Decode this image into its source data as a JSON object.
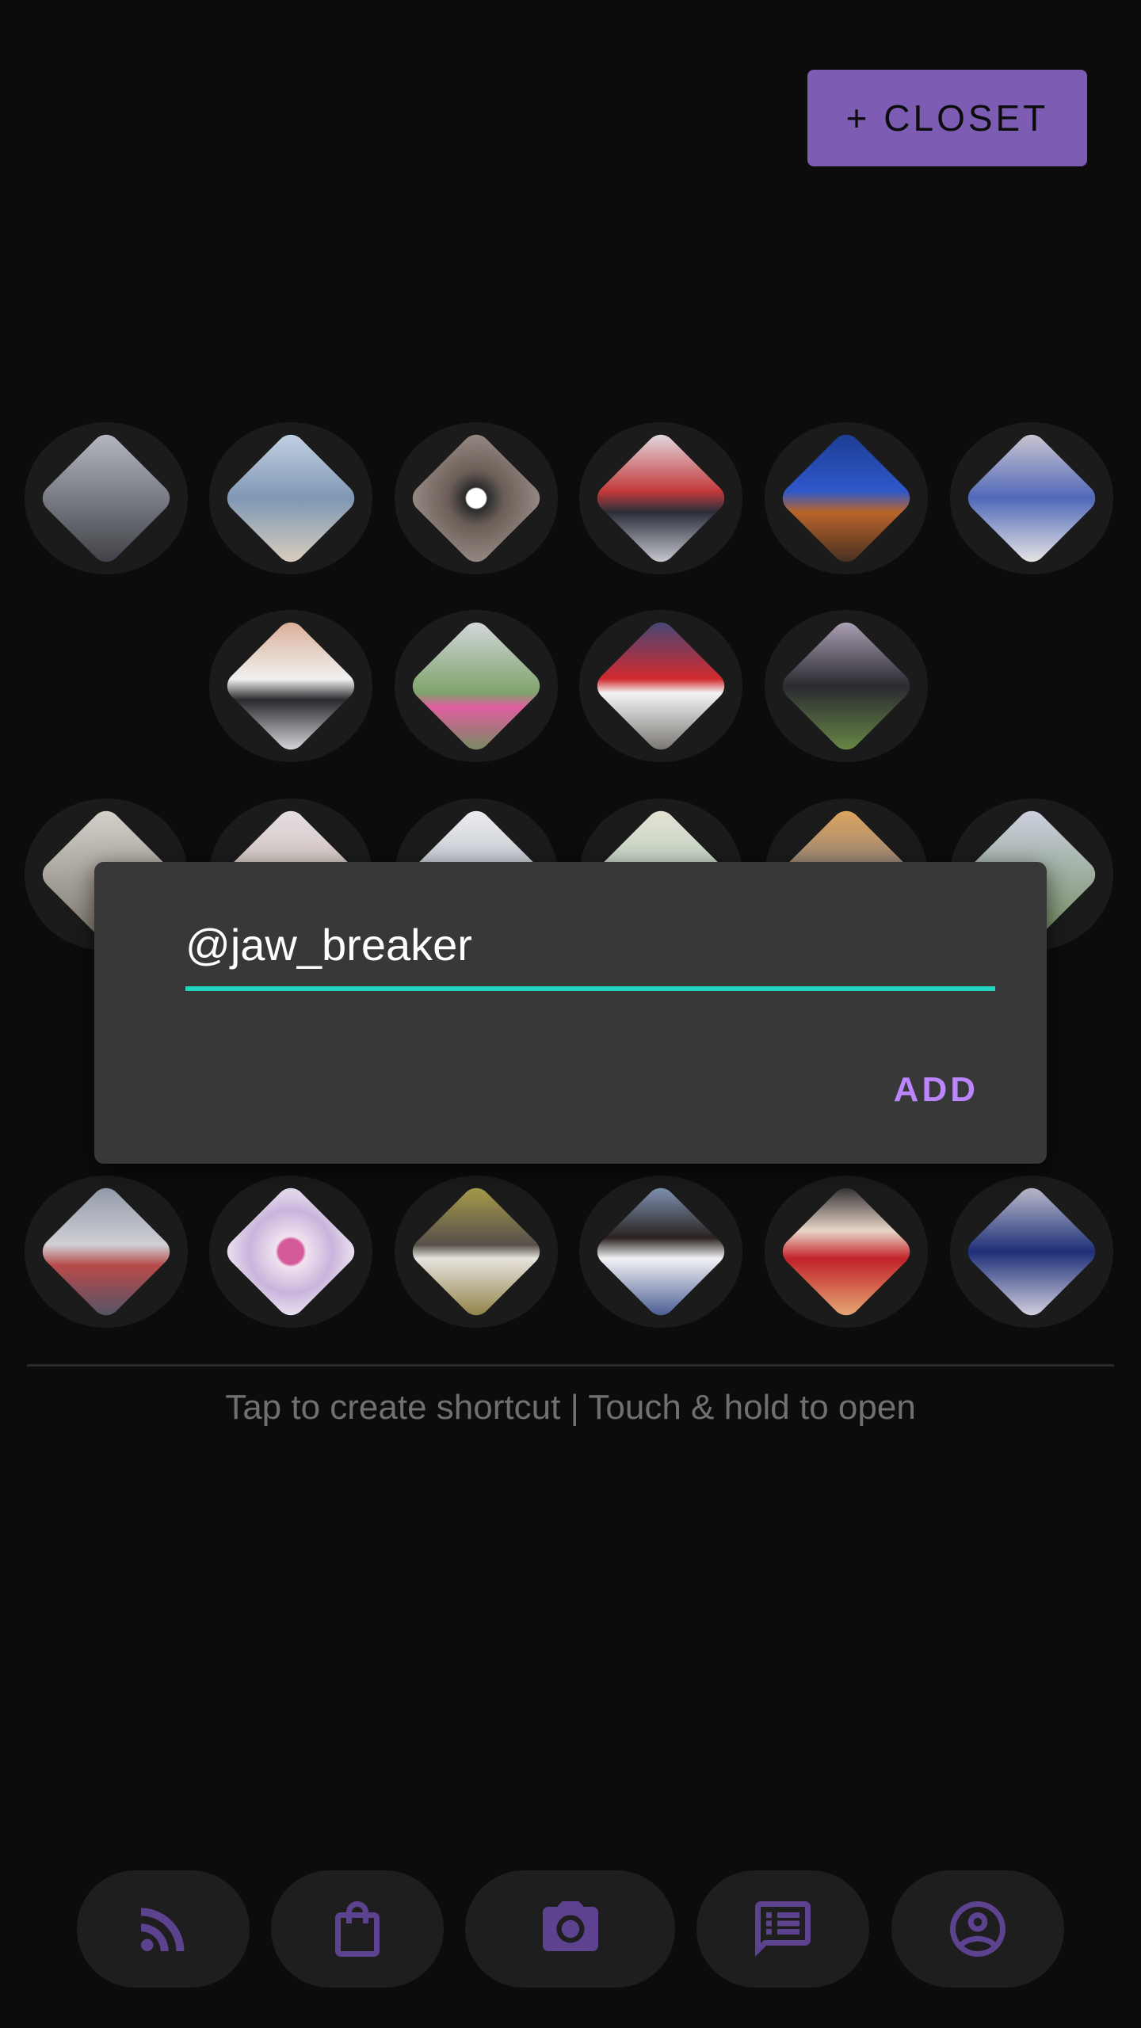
{
  "header": {
    "closet_button_label": "+ CLOSET"
  },
  "dialog": {
    "input_value": "@jaw_breaker",
    "add_label": "ADD"
  },
  "hint": "Tap to create shortcut | Touch & hold to open",
  "colors": {
    "accent": "#7d5db3",
    "dialog_button": "#bb86fc",
    "underline": "#22d3bf"
  },
  "nav": {
    "items": [
      {
        "icon": "rss-feed-icon"
      },
      {
        "icon": "shopping-bag-icon"
      },
      {
        "icon": "camera-icon"
      },
      {
        "icon": "message-icon"
      },
      {
        "icon": "account-circle-icon"
      }
    ]
  }
}
